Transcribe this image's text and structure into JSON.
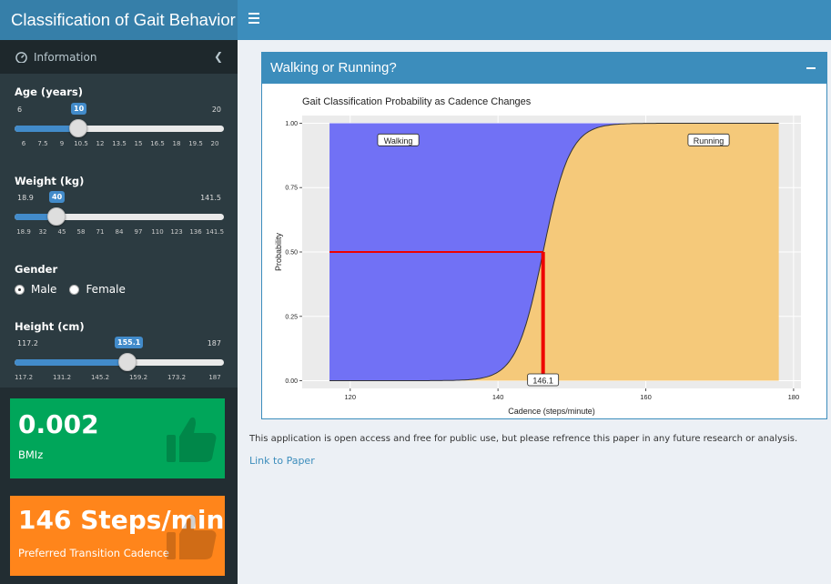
{
  "app": {
    "title": "Classification of Gait Behavior"
  },
  "sidebar": {
    "menu_label": "Information",
    "age": {
      "label": "Age (years)",
      "min": "6",
      "max": "20",
      "value": "10",
      "ticks": [
        "6",
        "7.5",
        "9",
        "10.5",
        "12",
        "13.5",
        "15",
        "16.5",
        "18",
        "19.5",
        "20"
      ]
    },
    "weight": {
      "label": "Weight (kg)",
      "min": "18.9",
      "max": "141.5",
      "value": "40",
      "ticks": [
        "18.9",
        "32",
        "45",
        "58",
        "71",
        "84",
        "97",
        "110",
        "123",
        "136",
        "141.5"
      ]
    },
    "gender": {
      "label": "Gender",
      "options": [
        "Male",
        "Female"
      ],
      "selected": "Male"
    },
    "height": {
      "label": "Height (cm)",
      "min": "117.2",
      "max": "187",
      "value": "155.1",
      "ticks": [
        "117.2",
        "131.2",
        "145.2",
        "159.2",
        "173.2",
        "187"
      ]
    }
  },
  "stats": {
    "bmiz_value": "0.002",
    "bmiz_label": "BMIz",
    "cadence_value": "146 Steps/min",
    "cadence_label": "Preferred Transition Cadence"
  },
  "panel": {
    "title": "Walking or Running?"
  },
  "chart_data": {
    "type": "area",
    "title": "Gait Classification Probability as Cadence Changes",
    "xlabel": "Cadence (steps/minute)",
    "ylabel": "Probability",
    "xlim": [
      113.5,
      181
    ],
    "ylim": [
      -0.03,
      1.03
    ],
    "xticks": [
      120,
      140,
      160,
      180
    ],
    "yticks": [
      0.0,
      0.25,
      0.5,
      0.75,
      1.0
    ],
    "ytick_labels": [
      "0.00",
      "0.25",
      "0.50",
      "0.75",
      "1.00"
    ],
    "x_range": [
      117.2,
      178
    ],
    "series": [
      {
        "name": "Walking",
        "color": "#7171f5"
      },
      {
        "name": "Running",
        "color": "#f5c97a"
      }
    ],
    "logistic": {
      "midpoint": 146.1,
      "slope": 0.55
    },
    "annotations": [
      "Walking",
      "Running",
      "146.1"
    ],
    "transition": {
      "x": 146.1,
      "y": 0.5
    },
    "grid": true
  },
  "footer": {
    "text": "This application is open access and free for public use, but please refrence this paper in any future research or analysis.",
    "link": "Link to Paper"
  }
}
